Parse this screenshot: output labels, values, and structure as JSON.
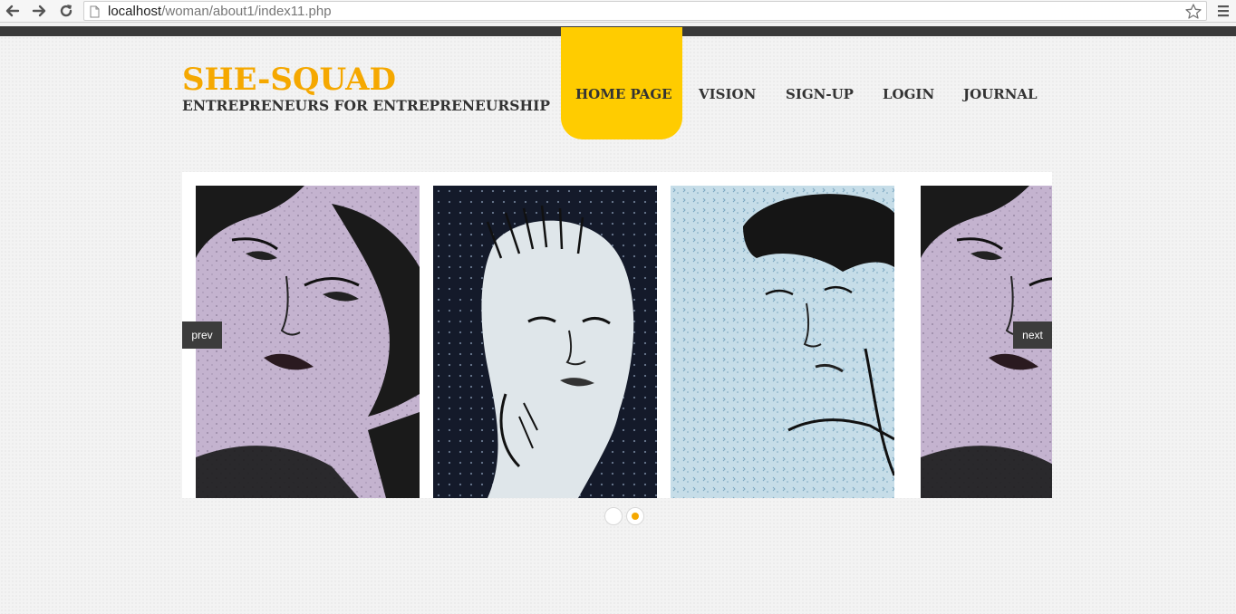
{
  "browser": {
    "url_host": "localhost",
    "url_path": "/woman/about1/index11.php"
  },
  "site": {
    "title": "SHE-SQUAD",
    "tagline": "ENTREPRENEURS FOR ENTREPRENEURSHIP",
    "accent_color": "#ffcc00",
    "title_color": "#f5a800"
  },
  "nav": {
    "items": [
      {
        "label": "HOME PAGE",
        "active": true
      },
      {
        "label": "VISION",
        "active": false
      },
      {
        "label": "SIGN-UP",
        "active": false
      },
      {
        "label": "LOGIN",
        "active": false
      },
      {
        "label": "JOURNAL",
        "active": false
      }
    ]
  },
  "slider": {
    "prev_label": "prev",
    "next_label": "next",
    "slides": [
      {
        "image": "embroidered-woman-portrait-lilac"
      },
      {
        "image": "embroidered-woman-portrait-navy"
      },
      {
        "image": "embroidered-woman-portrait-lightblue"
      },
      {
        "image": "embroidered-woman-portrait-lilac"
      }
    ],
    "page_count": 2,
    "active_page": 2
  }
}
